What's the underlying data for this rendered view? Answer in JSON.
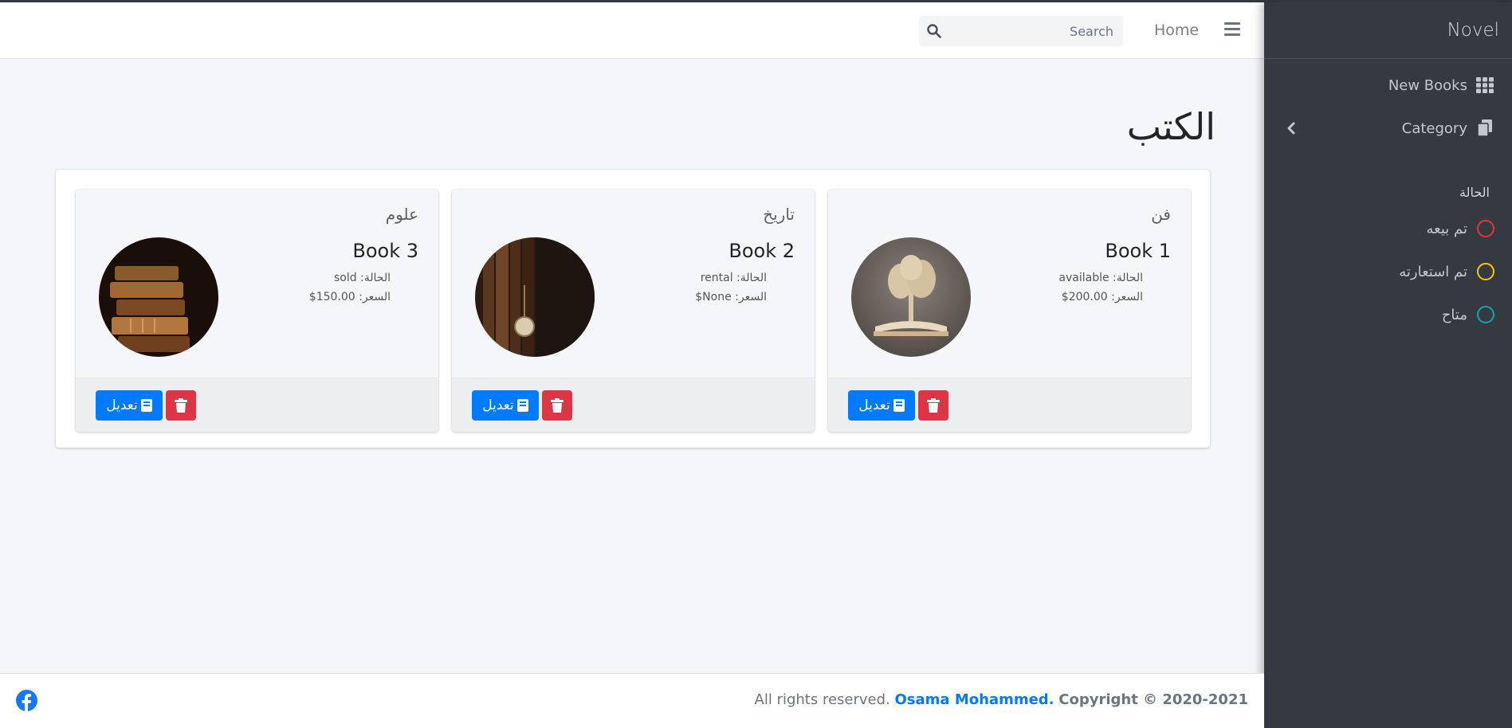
{
  "sidebar": {
    "brand": "Novel",
    "nav": [
      {
        "label": "New Books",
        "icon": "grid-icon"
      },
      {
        "label": "Category",
        "icon": "copy-icon"
      }
    ],
    "status_header": "الحالة",
    "statuses": [
      {
        "label": "تم بيعه",
        "color": "#dc3545"
      },
      {
        "label": "تم استعارته",
        "color": "#ffc107"
      },
      {
        "label": "متاح",
        "color": "#17a2b8"
      }
    ]
  },
  "header": {
    "home": "Home",
    "search_placeholder": "Search"
  },
  "main": {
    "title": "الكتب",
    "edit_label": "تعديل",
    "books": [
      {
        "category": "فن",
        "title": "Book 1",
        "status_line": "الحالة: available",
        "price_line": "السعر: 200.00$"
      },
      {
        "category": "تاريخ",
        "title": "Book 2",
        "status_line": "الحالة: rental",
        "price_line": "السعر: None$"
      },
      {
        "category": "علوم",
        "title": "Book 3",
        "status_line": "الحالة: sold",
        "price_line": "السعر: 150.00$"
      }
    ]
  },
  "footer": {
    "copyright_prefix": "Copyright © 2020-2021",
    "author": "Osama Mohammed.",
    "rights": "All rights reserved."
  },
  "colors": {
    "sidebar_bg": "#343a40",
    "primary": "#007bff",
    "danger": "#dc3545"
  }
}
